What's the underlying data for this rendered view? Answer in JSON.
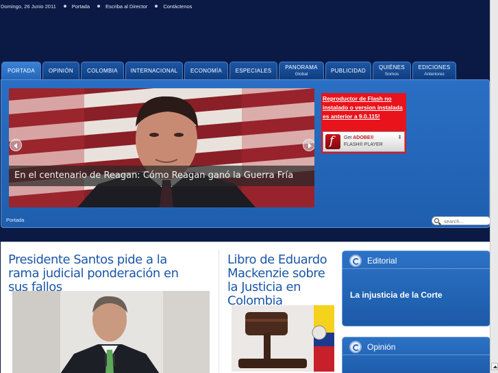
{
  "topbar": {
    "date": "Domingo, 26 Junio 2011",
    "links": [
      "Portada",
      "Escriba al Director",
      "Contáctenos"
    ]
  },
  "tabs": [
    {
      "label": "PORTADA",
      "sub": "",
      "active": true
    },
    {
      "label": "OPINIÓN",
      "sub": ""
    },
    {
      "label": "COLOMBIA",
      "sub": ""
    },
    {
      "label": "INTERNACIONAL",
      "sub": ""
    },
    {
      "label": "ECONOMÍA",
      "sub": ""
    },
    {
      "label": "ESPECIALES",
      "sub": ""
    },
    {
      "label": "PANORAMA",
      "sub": "Global"
    },
    {
      "label": "PUBLICIDAD",
      "sub": ""
    },
    {
      "label": "QUIÉNES",
      "sub": "Somos"
    },
    {
      "label": "EDICIONES",
      "sub": "Anteriores"
    }
  ],
  "slider": {
    "caption": "En el centenario de Reagan: Cómo Reagan ganó la Guerra Fría"
  },
  "flash": {
    "message": "Reproductor de Flash no instalado o version instalada es anterior a 9.0.115!",
    "get_line1_prefix": "Get ",
    "get_line1_brand": "ADOBE®",
    "get_line2": "FLASH® PLAYER"
  },
  "breadcrumb": "Portada",
  "search": {
    "placeholder": "search..."
  },
  "stories": [
    {
      "title": "Presidente Santos pide a la rama judicial ponderación en sus fallos"
    },
    {
      "title": "Libro de Eduardo Mackenzie sobre la Justicia en Colombia"
    }
  ],
  "sidebar": {
    "editorial": {
      "title": "Editorial",
      "link": "La injusticia de la Corte"
    },
    "opinion": {
      "title": "Opinión"
    }
  },
  "colors": {
    "page_bg": "#0b1a44",
    "panel": "#1f5eae",
    "headline": "#1a57a8",
    "flash_red": "#e8131b"
  }
}
